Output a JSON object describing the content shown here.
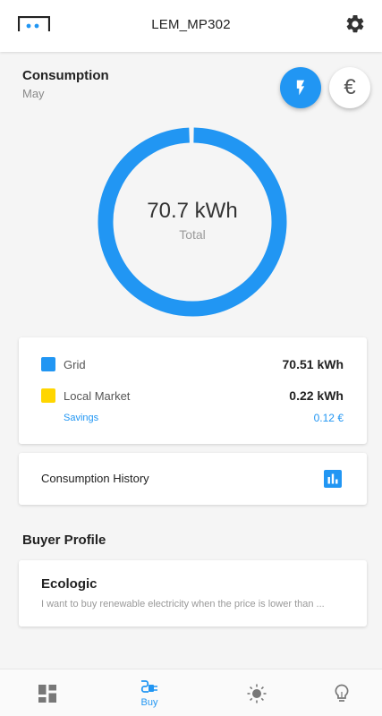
{
  "header": {
    "title": "LEM_MP302",
    "logo_icon": "app-logo-icon",
    "settings_icon": "gear-icon"
  },
  "consumption": {
    "title": "Consumption",
    "period": "May",
    "mode_buttons": [
      {
        "icon": "lightning-icon",
        "active": true
      },
      {
        "icon": "euro-icon",
        "glyph": "€",
        "active": false
      }
    ],
    "total_value": "70.7 kWh",
    "total_label": "Total"
  },
  "chart_data": {
    "type": "pie",
    "categories": [
      "Grid",
      "Local Market"
    ],
    "values": [
      70.51,
      0.22
    ],
    "colors": [
      "#2196f3",
      "#ffd600"
    ]
  },
  "breakdown": {
    "items": [
      {
        "label": "Grid",
        "value": "70.51 kWh",
        "color": "#2196f3"
      },
      {
        "label": "Local Market",
        "value": "0.22 kWh",
        "color": "#ffd600"
      }
    ],
    "savings_label": "Savings",
    "savings_value": "0.12 €"
  },
  "history": {
    "label": "Consumption History",
    "icon": "bar-chart-icon"
  },
  "buyer_profile": {
    "title": "Buyer Profile",
    "name": "Ecologic",
    "description": "I want to buy renewable electricity when the price is lower than ..."
  },
  "bottom_nav": {
    "items": [
      {
        "icon": "dashboard-icon",
        "label": ""
      },
      {
        "icon": "plug-icon",
        "label": "Buy",
        "active": true
      },
      {
        "icon": "sun-icon",
        "label": ""
      },
      {
        "icon": "lightbulb-icon",
        "label": ""
      }
    ]
  },
  "colors": {
    "accent": "#2196f3",
    "local_market": "#ffd600"
  }
}
